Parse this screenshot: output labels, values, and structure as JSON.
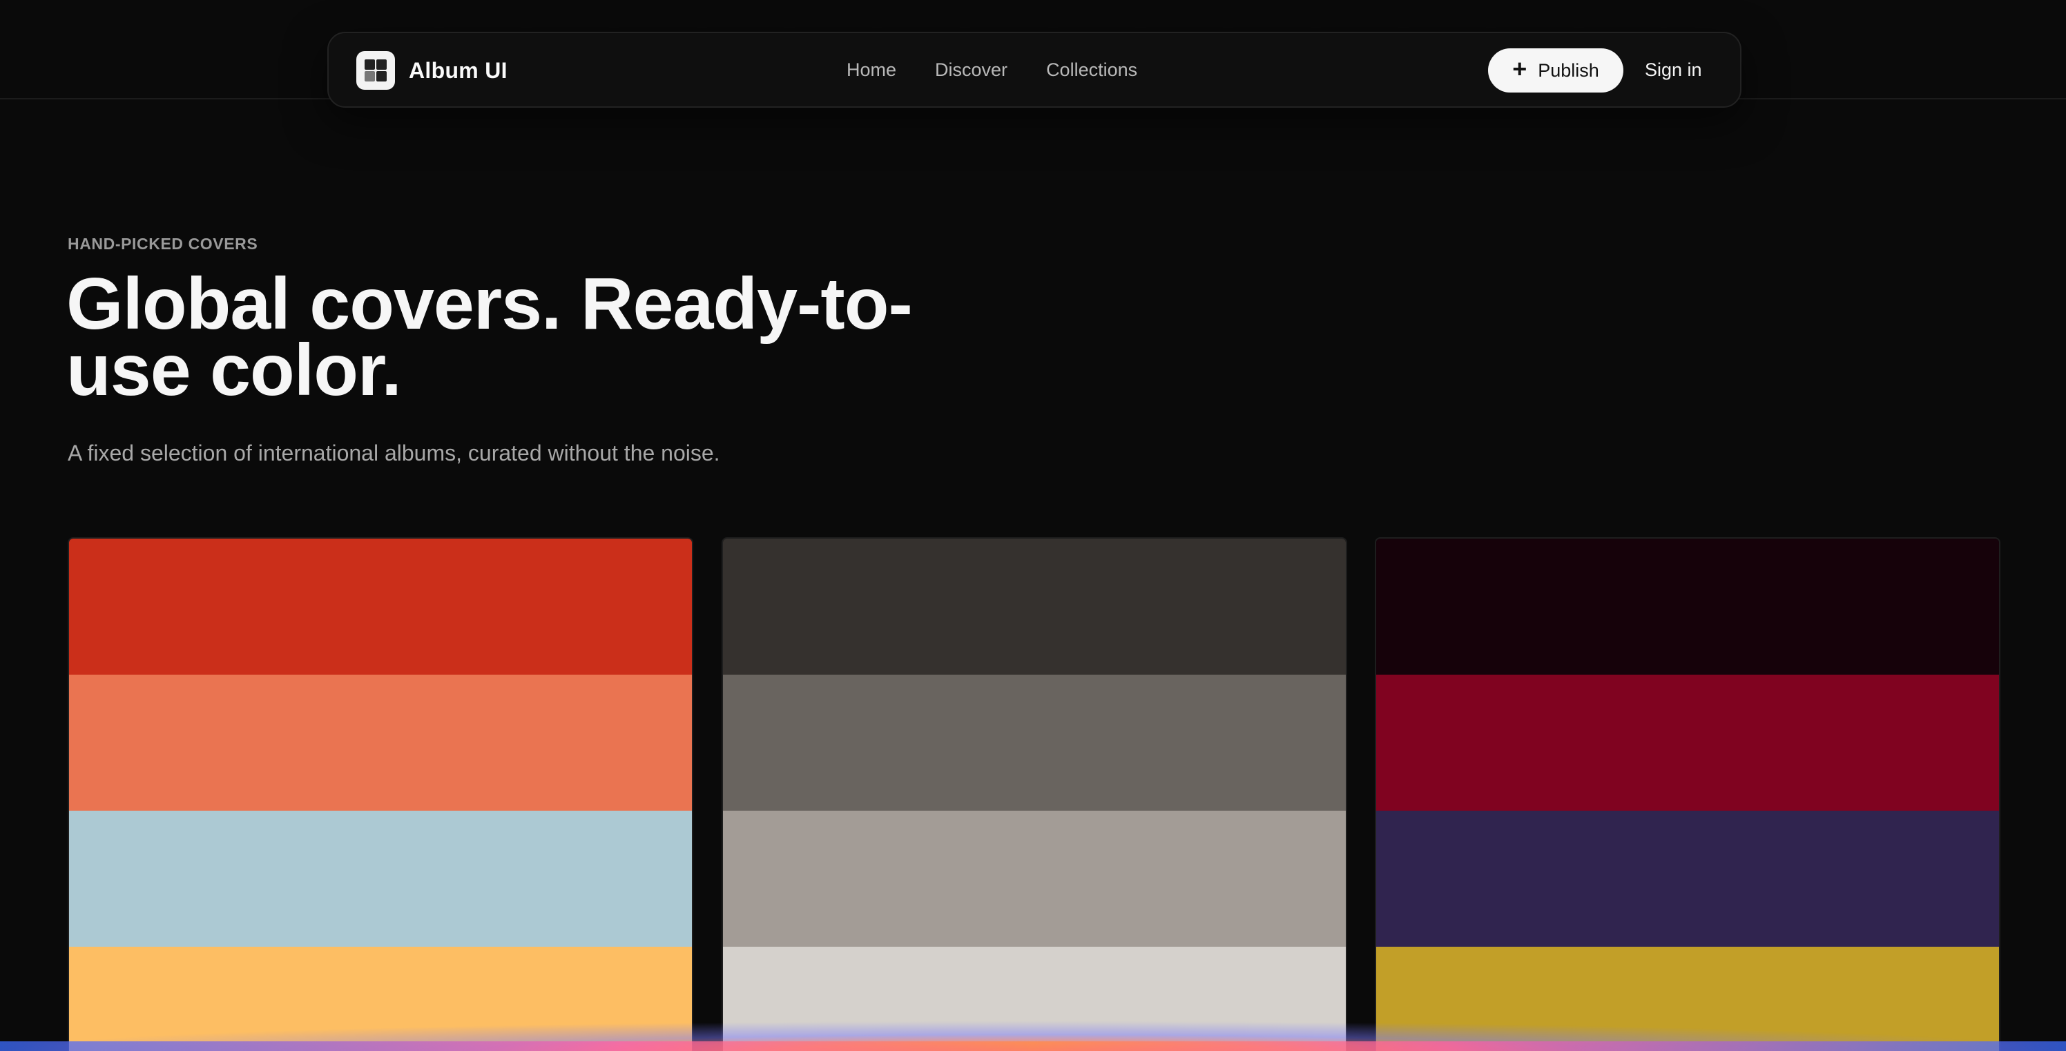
{
  "header": {
    "brand": "Album UI",
    "nav": [
      {
        "label": "Home"
      },
      {
        "label": "Discover"
      },
      {
        "label": "Collections"
      }
    ],
    "publish_label": "Publish",
    "signin_label": "Sign in"
  },
  "hero": {
    "eyebrow": "HAND-PICKED COVERS",
    "title": "Global covers. Ready-to-use color.",
    "subtitle": "A fixed selection of international albums, curated without the noise."
  },
  "covers": [
    {
      "swatches": [
        "#cb2f1a",
        "#ea7451",
        "#acc9d3",
        "#fdbe63"
      ]
    },
    {
      "swatches": [
        "#35312e",
        "#69645f",
        "#a39c96",
        "#d5d1cc"
      ]
    },
    {
      "swatches": [
        "#16020a",
        "#800320",
        "#30244f",
        "#c29f28"
      ]
    }
  ],
  "icons": {
    "logo": "app-logo-icon",
    "publish": "plus-icon"
  }
}
